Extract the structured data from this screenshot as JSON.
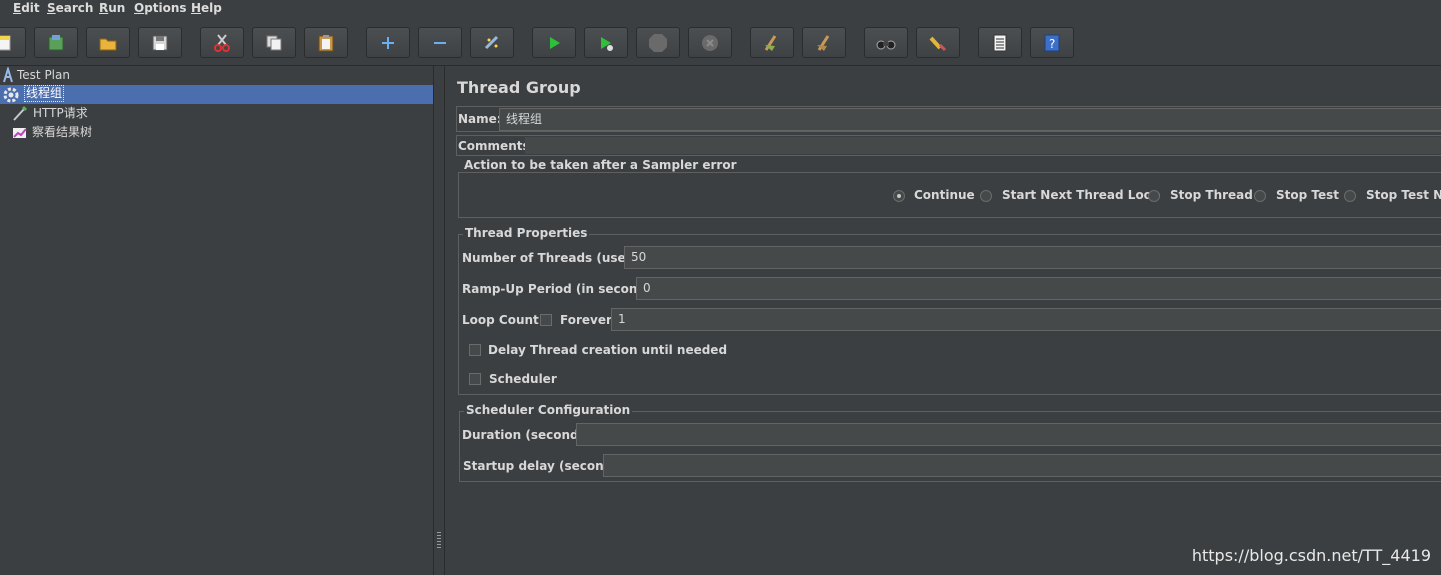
{
  "menu": {
    "items": [
      {
        "first": "E",
        "rest": "dit"
      },
      {
        "first": "S",
        "rest": "earch"
      },
      {
        "first": "R",
        "rest": "un"
      },
      {
        "first": "O",
        "rest": "ptions"
      },
      {
        "first": "H",
        "rest": "elp"
      }
    ]
  },
  "toolbar": {
    "icons": [
      "new-icon",
      "templates-icon",
      "open-icon",
      "save-icon",
      "cut-icon",
      "copy-icon",
      "paste-icon",
      "expand-icon",
      "collapse-icon",
      "toggle-icon",
      "start-icon",
      "start-no-pause-icon",
      "stop-icon",
      "shutdown-icon",
      "clear-icon",
      "clear-all-icon",
      "search-icon",
      "reset-search-icon",
      "function-helper-icon",
      "help-icon"
    ]
  },
  "tree": {
    "items": [
      {
        "label": "Test Plan",
        "icon": "test-plan-icon"
      },
      {
        "label": "线程组",
        "icon": "thread-group-icon",
        "selected": true
      },
      {
        "label": "HTTP请求",
        "icon": "http-sampler-icon"
      },
      {
        "label": "察看结果树",
        "icon": "results-tree-icon"
      }
    ]
  },
  "panel": {
    "title": "Thread Group",
    "name_label": "Name:",
    "name_value": "线程组",
    "comments_label": "Comments:",
    "sampler_error": {
      "legend": "Action to be taken after a Sampler error",
      "options": [
        "Continue",
        "Start Next Thread Loop",
        "Stop Thread",
        "Stop Test",
        "Stop Test Now"
      ],
      "selected": "Continue"
    },
    "thread_props": {
      "legend": "Thread Properties",
      "threads_label": "Number of Threads (users):",
      "threads_value": "50",
      "rampup_label": "Ramp-Up Period (in seconds):",
      "rampup_value": "0",
      "loop_label": "Loop Count:",
      "forever_label": "Forever",
      "loop_value": "1",
      "delay_label": "Delay Thread creation until needed",
      "scheduler_label": "Scheduler"
    },
    "scheduler_config": {
      "legend": "Scheduler Configuration",
      "duration_label": "Duration (seconds)",
      "duration_value": "",
      "startup_label": "Startup delay (seconds)",
      "startup_value": ""
    }
  },
  "watermark": "https://blog.csdn.net/TT_4419",
  "colors": {
    "background": "#3c3f41",
    "selection": "#4b6eaf",
    "field": "#45494a",
    "text": "#d8d8d8"
  }
}
